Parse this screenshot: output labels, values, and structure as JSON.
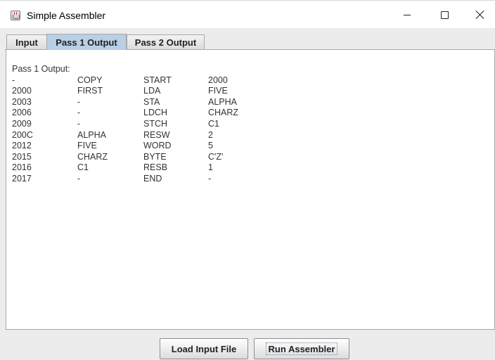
{
  "window": {
    "title": "Simple Assembler",
    "controls": [
      "minimize",
      "maximize",
      "close"
    ]
  },
  "tabs": [
    {
      "label": "Input",
      "active": false
    },
    {
      "label": "Pass 1 Output",
      "active": true
    },
    {
      "label": "Pass 2 Output",
      "active": false
    }
  ],
  "output": {
    "heading": "Pass 1 Output:",
    "rows": [
      [
        "-",
        "COPY",
        "START",
        "2000"
      ],
      [
        "2000",
        "FIRST",
        "LDA",
        "FIVE"
      ],
      [
        "2003",
        "-",
        "STA",
        "ALPHA"
      ],
      [
        "2006",
        "-",
        "LDCH",
        "CHARZ"
      ],
      [
        "2009",
        "-",
        "STCH",
        "C1"
      ],
      [
        "200C",
        "ALPHA",
        "RESW",
        "2"
      ],
      [
        "2012",
        "FIVE",
        "WORD",
        "5"
      ],
      [
        "2015",
        "CHARZ",
        "BYTE",
        "C'Z'"
      ],
      [
        "2016",
        "C1",
        "RESB",
        "1"
      ],
      [
        "2017",
        "-",
        "END",
        "-"
      ]
    ]
  },
  "buttons": {
    "load": "Load Input File",
    "run": "Run Assembler"
  },
  "icons": {
    "app": "java-cup-icon",
    "minimize": "minimize-icon",
    "maximize": "maximize-icon",
    "close": "close-icon"
  }
}
